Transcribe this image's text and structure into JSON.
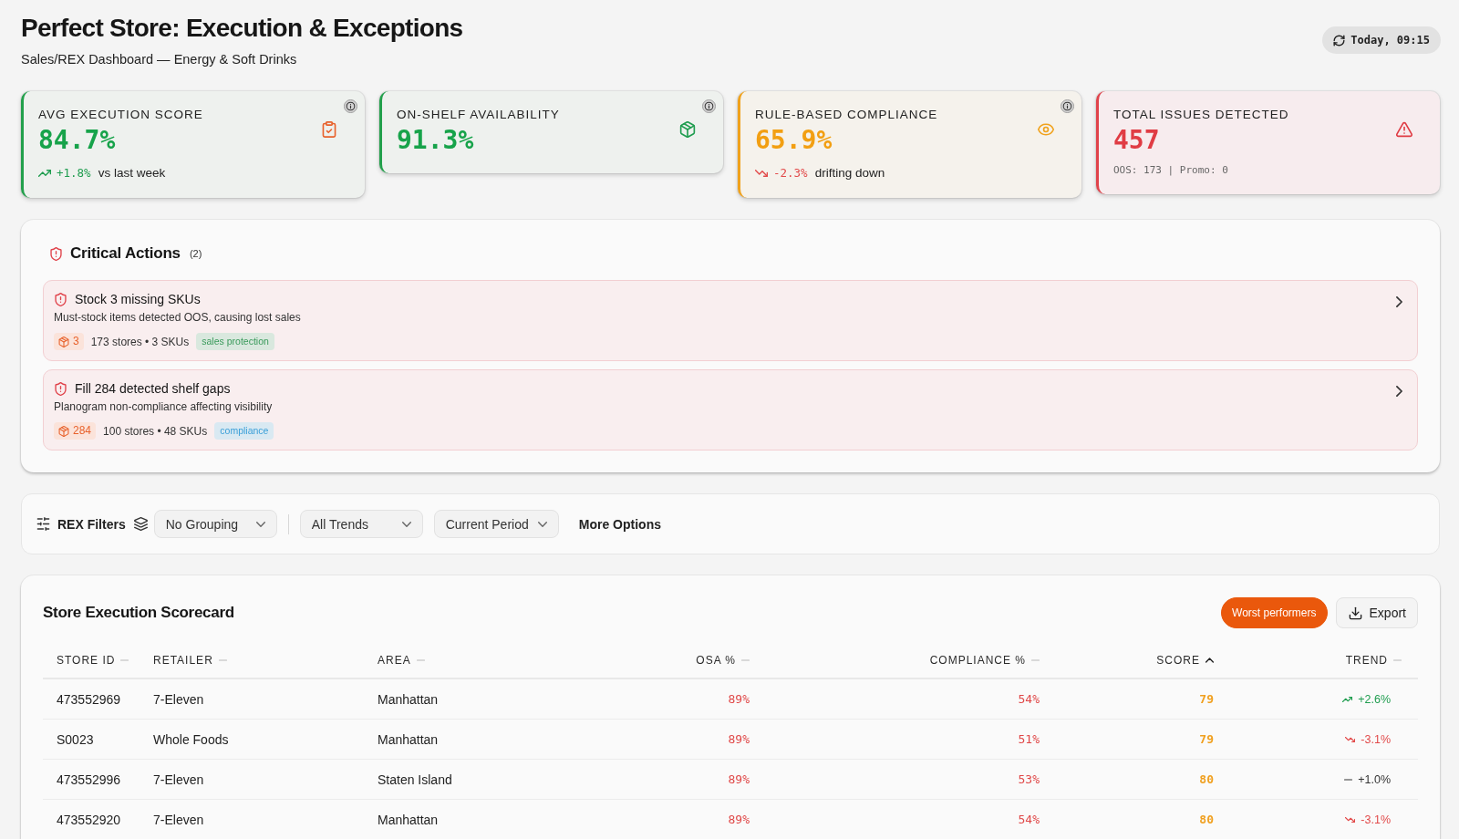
{
  "header": {
    "title": "Perfect Store: Execution & Exceptions",
    "subtitle": "Sales/REX Dashboard — Energy & Soft Drinks",
    "refresh_label": "Today, 09:15"
  },
  "kpis": [
    {
      "label": "AVG EXECUTION SCORE",
      "value": "84.7%",
      "kind": "good",
      "info": true,
      "delta": {
        "kind": "up",
        "value": "+1.8%",
        "text": "vs last week"
      }
    },
    {
      "label": "ON-SHELF AVAILABILITY",
      "value": "91.3%",
      "kind": "good",
      "info": true
    },
    {
      "label": "RULE-BASED COMPLIANCE",
      "value": "65.9%",
      "kind": "warning",
      "info": true,
      "delta": {
        "kind": "down",
        "value": "-2.3%",
        "text": "drifting down"
      }
    },
    {
      "label": "TOTAL ISSUES DETECTED",
      "value": "457",
      "kind": "critical",
      "info": false,
      "detail": "OOS: 173 | Promo: 0"
    }
  ],
  "critical_actions": {
    "title": "Critical Actions",
    "count": "(2)",
    "items": [
      {
        "title": "Stock 3 missing SKUs",
        "description": "Must-stock items detected OOS, causing lost sales",
        "count": "3",
        "meta": "173 stores • 3 SKUs",
        "tag": {
          "label": "sales protection",
          "color": "#3a9a5b"
        }
      },
      {
        "title": "Fill 284 detected shelf gaps",
        "description": "Planogram non-compliance affecting visibility",
        "count": "284",
        "meta": "100 stores • 48 SKUs",
        "tag": {
          "label": "compliance",
          "color": "#3a9fd8"
        }
      }
    ]
  },
  "filters": {
    "label": "REX Filters",
    "dropdowns": [
      {
        "value": "No Grouping"
      },
      {
        "value": "All Trends"
      },
      {
        "value": "Current Period"
      }
    ],
    "more_options": "More Options"
  },
  "scorecard": {
    "title": "Store Execution Scorecard",
    "worst_performers": {
      "label": "Worst performers",
      "selected": true
    },
    "export": "Export",
    "columns": [
      {
        "label": "STORE ID",
        "sorted": false
      },
      {
        "label": "RETAILER",
        "sorted": false
      },
      {
        "label": "AREA",
        "sorted": false
      },
      {
        "label": "OSA %",
        "sorted": false
      },
      {
        "label": "COMPLIANCE %",
        "sorted": false
      },
      {
        "label": "SCORE",
        "sorted": true
      },
      {
        "label": "TREND",
        "sorted": false
      }
    ],
    "rows": [
      {
        "store_id": "473552969",
        "retailer": "7-Eleven",
        "area": "Manhattan",
        "osa": "89%",
        "compliance": "54%",
        "score": "79",
        "trend": {
          "kind": "up",
          "value": "+2.6%"
        }
      },
      {
        "store_id": "S0023",
        "retailer": "Whole Foods",
        "area": "Manhattan",
        "osa": "89%",
        "compliance": "51%",
        "score": "79",
        "trend": {
          "kind": "down",
          "value": "-3.1%"
        }
      },
      {
        "store_id": "473552996",
        "retailer": "7-Eleven",
        "area": "Staten Island",
        "osa": "89%",
        "compliance": "53%",
        "score": "80",
        "trend": {
          "kind": "flat",
          "value": "+1.0%"
        }
      },
      {
        "store_id": "473552920",
        "retailer": "7-Eleven",
        "area": "Manhattan",
        "osa": "89%",
        "compliance": "54%",
        "score": "80",
        "trend": {
          "kind": "down",
          "value": "-3.1%"
        }
      }
    ]
  }
}
